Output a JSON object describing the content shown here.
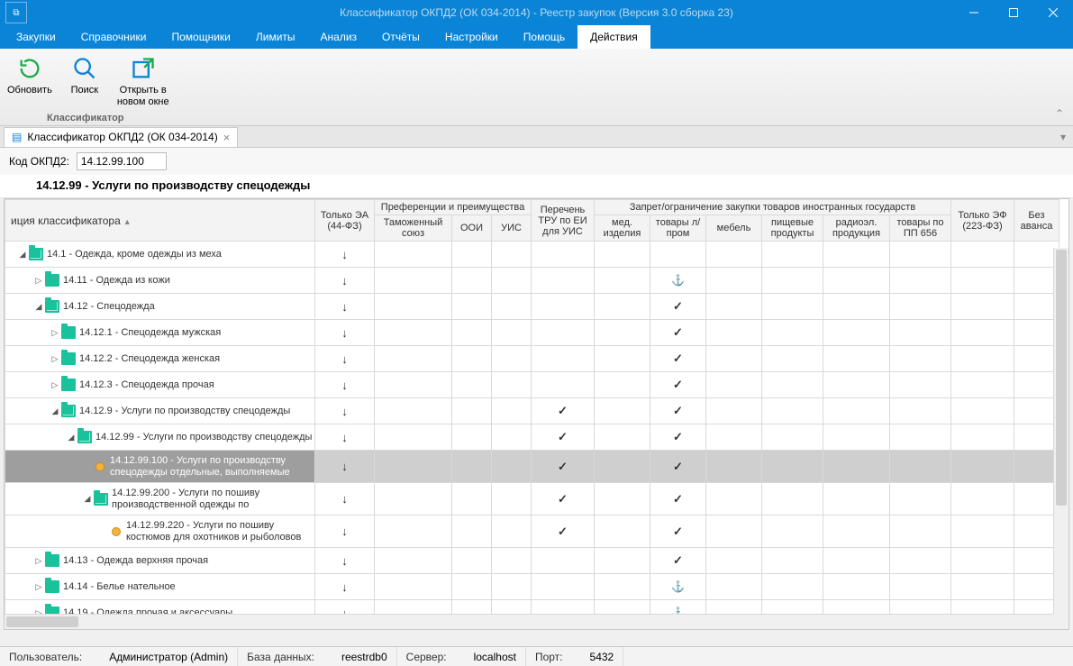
{
  "window": {
    "title": "Классификатор ОКПД2 (ОК 034-2014) - Реестр закупок (Версия 3.0 сборка 23)"
  },
  "menu": [
    "Закупки",
    "Справочники",
    "Помощники",
    "Лимиты",
    "Анализ",
    "Отчёты",
    "Настройки",
    "Помощь",
    "Действия"
  ],
  "menu_active": 8,
  "ribbon": {
    "buttons": [
      {
        "id": "refresh",
        "label": "Обновить"
      },
      {
        "id": "search",
        "label": "Поиск"
      },
      {
        "id": "open-new",
        "label": "Открыть в\nновом окне"
      }
    ],
    "group": "Классификатор"
  },
  "doc_tab": {
    "label": "Классификатор ОКПД2 (ОК 034-2014)"
  },
  "filter": {
    "label": "Код ОКПД2:",
    "value": "14.12.99.100"
  },
  "heading": "14.12.99 - Услуги по производству спецодежды",
  "columns": {
    "tree": "иция классификатора",
    "ea44": "Только ЭА\n(44-ФЗ)",
    "pref_group": "Преференции и преимущества",
    "pref": [
      "Таможенный союз",
      "ООИ",
      "УИС"
    ],
    "tru": "Перечень ТРУ по ЕИ для УИС",
    "ban_group": "Запрет/ограничение закупки товаров иностранных государств",
    "ban": [
      "мед. изделия",
      "товары л/пром",
      "мебель",
      "пищевые продукты",
      "радиоэл. продукция",
      "товары по ПП 656"
    ],
    "ef223": "Только ЭФ\n(223-ФЗ)",
    "noadv": "Без аванса"
  },
  "rows": [
    {
      "depth": 0,
      "exp": "open",
      "icon": "folder",
      "label": "14.1 - Одежда, кроме одежды из меха",
      "ea": "down"
    },
    {
      "depth": 1,
      "exp": "closed",
      "icon": "folder",
      "label": "14.11 - Одежда из кожи",
      "ea": "down",
      "lp": "anchor"
    },
    {
      "depth": 1,
      "exp": "open",
      "icon": "folder",
      "label": "14.12 - Спецодежда",
      "ea": "down",
      "lp": "check"
    },
    {
      "depth": 2,
      "exp": "closed",
      "icon": "folder",
      "label": "14.12.1 - Спецодежда мужская",
      "ea": "down",
      "lp": "check"
    },
    {
      "depth": 2,
      "exp": "closed",
      "icon": "folder",
      "label": "14.12.2 - Спецодежда женская",
      "ea": "down",
      "lp": "check"
    },
    {
      "depth": 2,
      "exp": "closed",
      "icon": "folder",
      "label": "14.12.3 - Спецодежда прочая",
      "ea": "down",
      "lp": "check"
    },
    {
      "depth": 2,
      "exp": "open",
      "icon": "folder",
      "label": "14.12.9 - Услуги по производству спецодежды",
      "ea": "down",
      "tru": "check",
      "lp": "check"
    },
    {
      "depth": 3,
      "exp": "open",
      "icon": "folder",
      "label": "14.12.99 - Услуги по производству спецодежды",
      "ea": "down",
      "tru": "check",
      "lp": "check"
    },
    {
      "depth": 4,
      "exp": "",
      "icon": "bullet",
      "label": "14.12.99.100 - Услуги по производству спецодежды отдельные, выполняемые",
      "ea": "down",
      "tru": "check",
      "lp": "check",
      "selected": true,
      "tall": true
    },
    {
      "depth": 4,
      "exp": "open",
      "icon": "folder",
      "label": "14.12.99.200 - Услуги по пошиву производственной одежды по",
      "ea": "down",
      "tru": "check",
      "lp": "check",
      "tall": true
    },
    {
      "depth": 5,
      "exp": "",
      "icon": "bullet",
      "label": "14.12.99.220 - Услуги по пошиву костюмов для охотников и рыболовов",
      "ea": "down",
      "tru": "check",
      "lp": "check",
      "tall": true
    },
    {
      "depth": 1,
      "exp": "closed",
      "icon": "folder",
      "label": "14.13 - Одежда верхняя прочая",
      "ea": "down",
      "lp": "check"
    },
    {
      "depth": 1,
      "exp": "closed",
      "icon": "folder",
      "label": "14.14 - Белье нательное",
      "ea": "down",
      "lp": "anchor"
    },
    {
      "depth": 1,
      "exp": "closed",
      "icon": "folder",
      "label": "14.19 - Одежда прочая и аксессуары",
      "ea": "down",
      "lp": "anchor"
    }
  ],
  "status": {
    "user_label": "Пользователь:",
    "user_value": "Администратор (Admin)",
    "db_label": "База данных:",
    "db_value": "reestrdb0",
    "server_label": "Сервер:",
    "server_value": "localhost",
    "port_label": "Порт:",
    "port_value": "5432"
  }
}
